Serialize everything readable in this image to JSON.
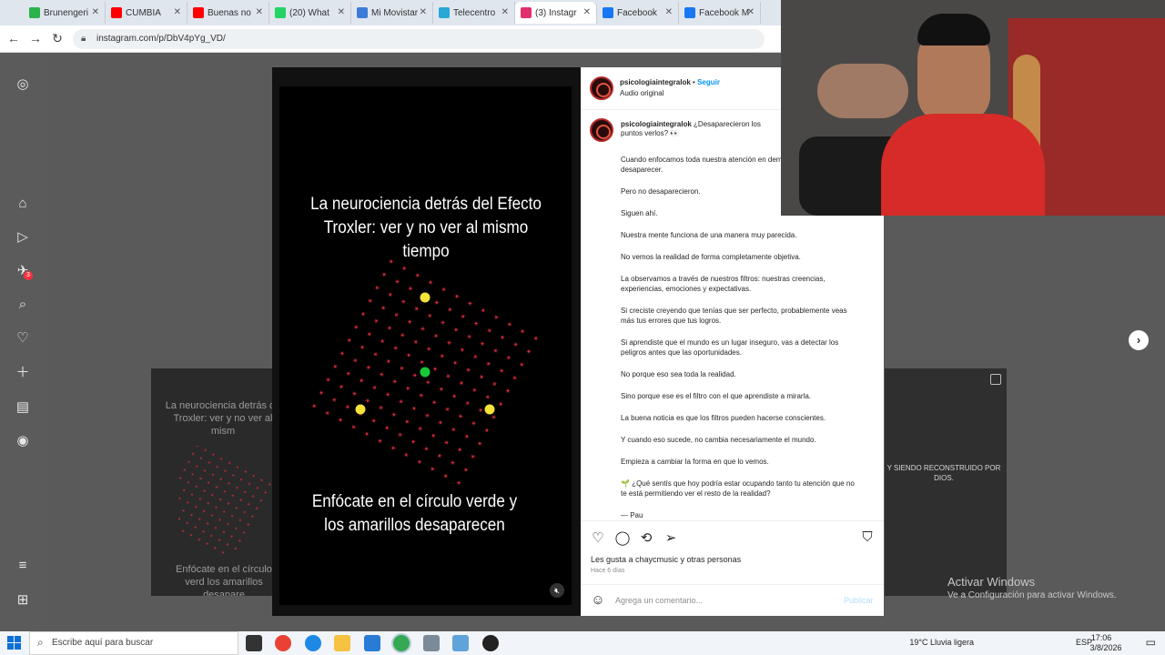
{
  "browser": {
    "tabs": [
      {
        "label": "Brunengeri",
        "color": "#2bb24c"
      },
      {
        "label": "CUMBIA",
        "color": "#ff0000"
      },
      {
        "label": "Buenas no",
        "color": "#ff0000"
      },
      {
        "label": "(20) What",
        "color": "#25d366"
      },
      {
        "label": "Mi Movistar",
        "color": "#3d7bd8"
      },
      {
        "label": "Telecentro",
        "color": "#29a8d8"
      },
      {
        "label": "(3) Instagr",
        "color": "#e1306c"
      },
      {
        "label": "Facebook",
        "color": "#1877f2"
      },
      {
        "label": "Facebook M",
        "color": "#1877f2"
      }
    ],
    "url": "instagram.com/p/DbV4pYg_VD/"
  },
  "rail": {
    "notification_count": "3"
  },
  "video": {
    "title": "La neurociencia detrás del Efecto Troxler: ver y no ver al mismo tiempo",
    "instruction": "Enfócate en el círculo verde y los amarillos desaparecen",
    "dot_green": "#19c93a",
    "dot_yellow": "#f5e33a",
    "grid_color": "#d92c3a"
  },
  "background": {
    "left_title": "La neurociencia detrás de Troxler: ver y no ver al mism",
    "left_instruction": "Enfócate en el círculo verd los amarillos desapare",
    "right_text": "Y SIENDO RECONSTRUIDO POR DIOS."
  },
  "post": {
    "username": "psicologiaintegralok",
    "follow_label": "Seguir",
    "audio": "Audio original",
    "caption_lead": "¿Desaparecieron los puntos verlos? 👀",
    "caption": [
      "Cuando enfocamos toda nuestra atención en demás parecen desaparecer.",
      "Pero no desaparecieron.",
      "Siguen ahí.",
      "Nuestra mente funciona de una manera muy parecida.",
      "No vemos la realidad de forma completamente objetiva.",
      "La observamos a través de nuestros filtros: nuestras creencias, experiencias, emociones y expectativas.",
      "Si creciste creyendo que tenías que ser perfecto, probablemente veas más tus errores que tus logros.",
      "Si aprendiste que el mundo es un lugar inseguro, vas a detectar los peligros antes que las oportunidades.",
      "No porque eso sea toda la realidad.",
      "Sino porque ese es el filtro con el que aprendiste a mirarla.",
      "La buena noticia es que los filtros pueden hacerse conscientes.",
      "Y cuando eso sucede, no cambia necesariamente el mundo.",
      "Empieza a cambiar la forma en que lo vemos.",
      "🌱 ¿Qué sentís que hoy podría estar ocupando tanto tu atención que no te está permitiendo ver el resto de la realidad?",
      "— Pau"
    ],
    "likes": "Les gusta a chaycmusic y otras personas",
    "time": "Hace 6 días",
    "comment_placeholder": "Agrega un comentario...",
    "publish_label": "Publicar"
  },
  "watermark": {
    "title": "Activar Windows",
    "subtitle": "Ve a Configuración para activar Windows."
  },
  "taskbar": {
    "search_placeholder": "Escribe aquí para buscar",
    "weather": "19°C  Lluvia ligera",
    "lang": "ESP",
    "time": "17:06",
    "date": "3/8/2026"
  }
}
